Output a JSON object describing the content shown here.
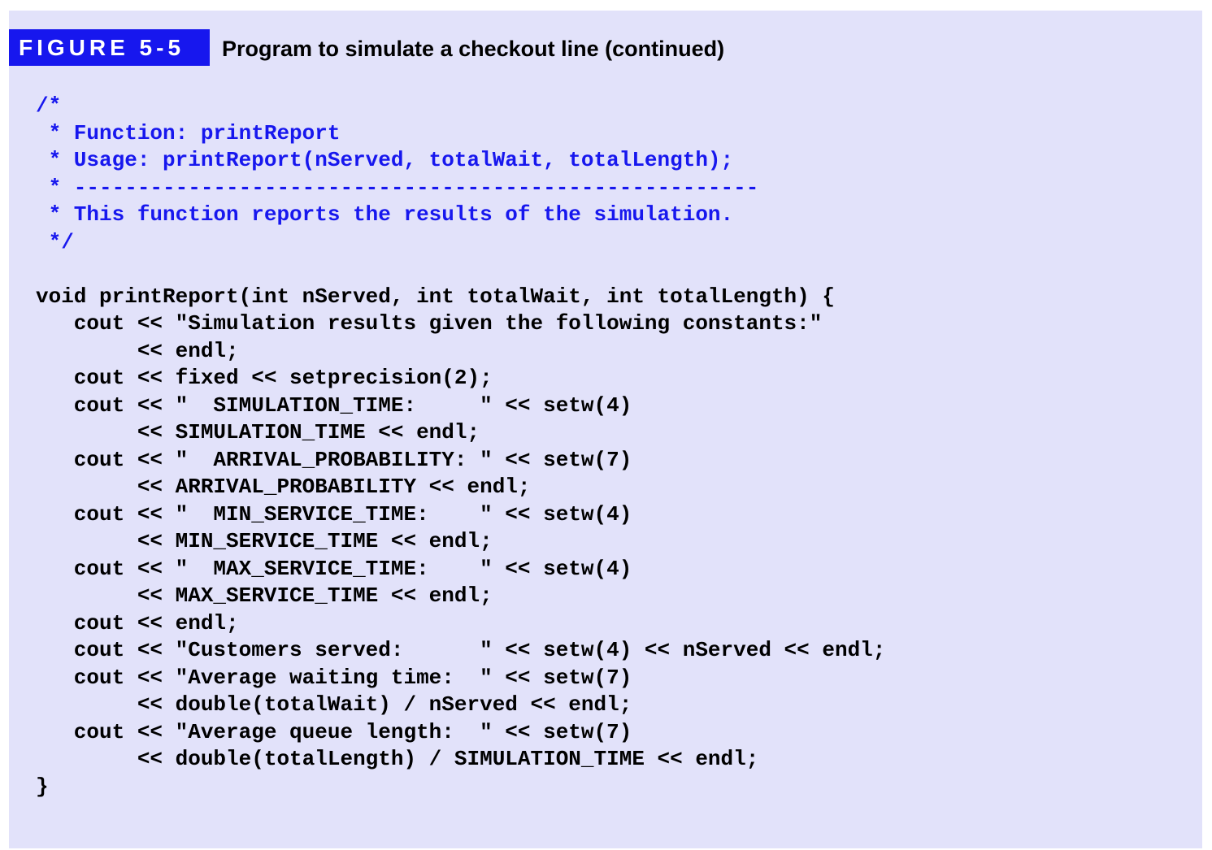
{
  "figure": {
    "label": "FIGURE 5-5",
    "title": "Program to simulate a checkout line (continued)"
  },
  "code_lines": [
    {
      "text": "/*",
      "kind": "comment"
    },
    {
      "text": " * Function: printReport",
      "kind": "comment"
    },
    {
      "text": " * Usage: printReport(nServed, totalWait, totalLength);",
      "kind": "comment"
    },
    {
      "text": " * ------------------------------------------------------",
      "kind": "comment"
    },
    {
      "text": " * This function reports the results of the simulation.",
      "kind": "comment"
    },
    {
      "text": " */",
      "kind": "comment"
    },
    {
      "text": "",
      "kind": "code"
    },
    {
      "text": "void printReport(int nServed, int totalWait, int totalLength) {",
      "kind": "code"
    },
    {
      "text": "   cout << \"Simulation results given the following constants:\"",
      "kind": "code"
    },
    {
      "text": "        << endl;",
      "kind": "code"
    },
    {
      "text": "   cout << fixed << setprecision(2);",
      "kind": "code"
    },
    {
      "text": "   cout << \"  SIMULATION_TIME:     \" << setw(4)",
      "kind": "code"
    },
    {
      "text": "        << SIMULATION_TIME << endl;",
      "kind": "code"
    },
    {
      "text": "   cout << \"  ARRIVAL_PROBABILITY: \" << setw(7)",
      "kind": "code"
    },
    {
      "text": "        << ARRIVAL_PROBABILITY << endl;",
      "kind": "code"
    },
    {
      "text": "   cout << \"  MIN_SERVICE_TIME:    \" << setw(4)",
      "kind": "code"
    },
    {
      "text": "        << MIN_SERVICE_TIME << endl;",
      "kind": "code"
    },
    {
      "text": "   cout << \"  MAX_SERVICE_TIME:    \" << setw(4)",
      "kind": "code"
    },
    {
      "text": "        << MAX_SERVICE_TIME << endl;",
      "kind": "code"
    },
    {
      "text": "   cout << endl;",
      "kind": "code"
    },
    {
      "text": "   cout << \"Customers served:      \" << setw(4) << nServed << endl;",
      "kind": "code"
    },
    {
      "text": "   cout << \"Average waiting time:  \" << setw(7)",
      "kind": "code"
    },
    {
      "text": "        << double(totalWait) / nServed << endl;",
      "kind": "code"
    },
    {
      "text": "   cout << \"Average queue length:  \" << setw(7)",
      "kind": "code"
    },
    {
      "text": "        << double(totalLength) / SIMULATION_TIME << endl;",
      "kind": "code"
    },
    {
      "text": "}",
      "kind": "code"
    }
  ],
  "colors": {
    "panel_background": "#e2e2fa",
    "badge_background": "#1717ee",
    "comment_text": "#1717ee",
    "code_text": "#000000"
  }
}
